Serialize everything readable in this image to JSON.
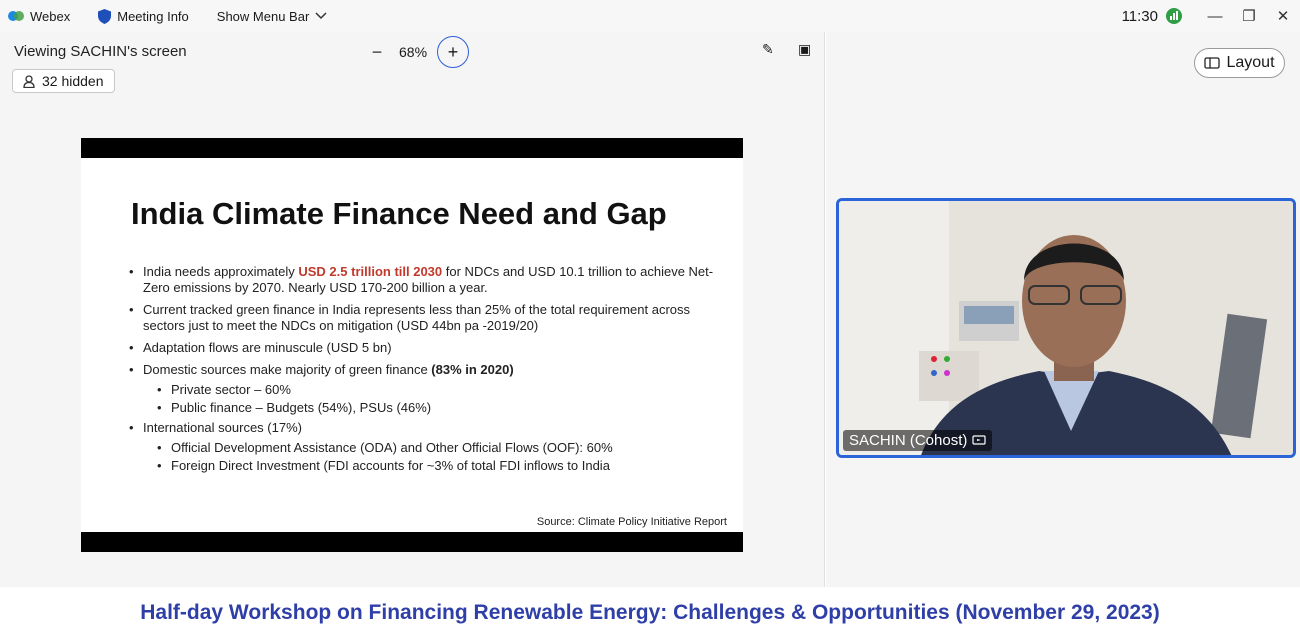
{
  "app": {
    "name": "Webex",
    "meeting_info": "Meeting Info",
    "menu_bar": "Show Menu Bar"
  },
  "status": {
    "time": "11:30"
  },
  "toolbar": {
    "viewing": "Viewing SACHIN's screen",
    "zoom": "68%",
    "zoom_out": "−",
    "zoom_in": "+"
  },
  "hidden_participants": "32 hidden",
  "layout_button": "Layout",
  "slide": {
    "title": "India Climate Finance Need and Gap",
    "bullets": [
      {
        "pre": "India needs approximately ",
        "highlight": "USD 2.5 trillion till 2030",
        "post": " for NDCs and USD 10.1 trillion to achieve Net-Zero emissions by 2070. Nearly USD 170-200 billion a year."
      },
      {
        "text": "Current tracked green finance in India represents less than 25% of the total requirement across sectors just to meet the NDCs on mitigation (USD 44bn pa -2019/20)"
      },
      {
        "text": "Adaptation flows are minuscule (USD 5 bn)"
      },
      {
        "pre": "Domestic sources make majority of green finance ",
        "bold": "(83% in 2020)"
      },
      {
        "text": "International sources (17%)"
      }
    ],
    "sub_domestic": [
      "Private sector – 60%",
      "Public finance – Budgets (54%), PSUs (46%)"
    ],
    "sub_international": [
      "Official Development Assistance (ODA) and Other Official Flows (OOF): 60%",
      "Foreign Direct Investment (FDI accounts for ~3% of total FDI inflows to India"
    ],
    "source": "Source: Climate Policy Initiative Report"
  },
  "video": {
    "name": "SACHIN (Cohost)"
  },
  "caption": "Half-day Workshop on Financing Renewable Energy: Challenges & Opportunities (November 29, 2023)",
  "colors": {
    "accent": "#2b63d8",
    "caption": "#2f3fa8",
    "highlight": "#c0392b"
  }
}
